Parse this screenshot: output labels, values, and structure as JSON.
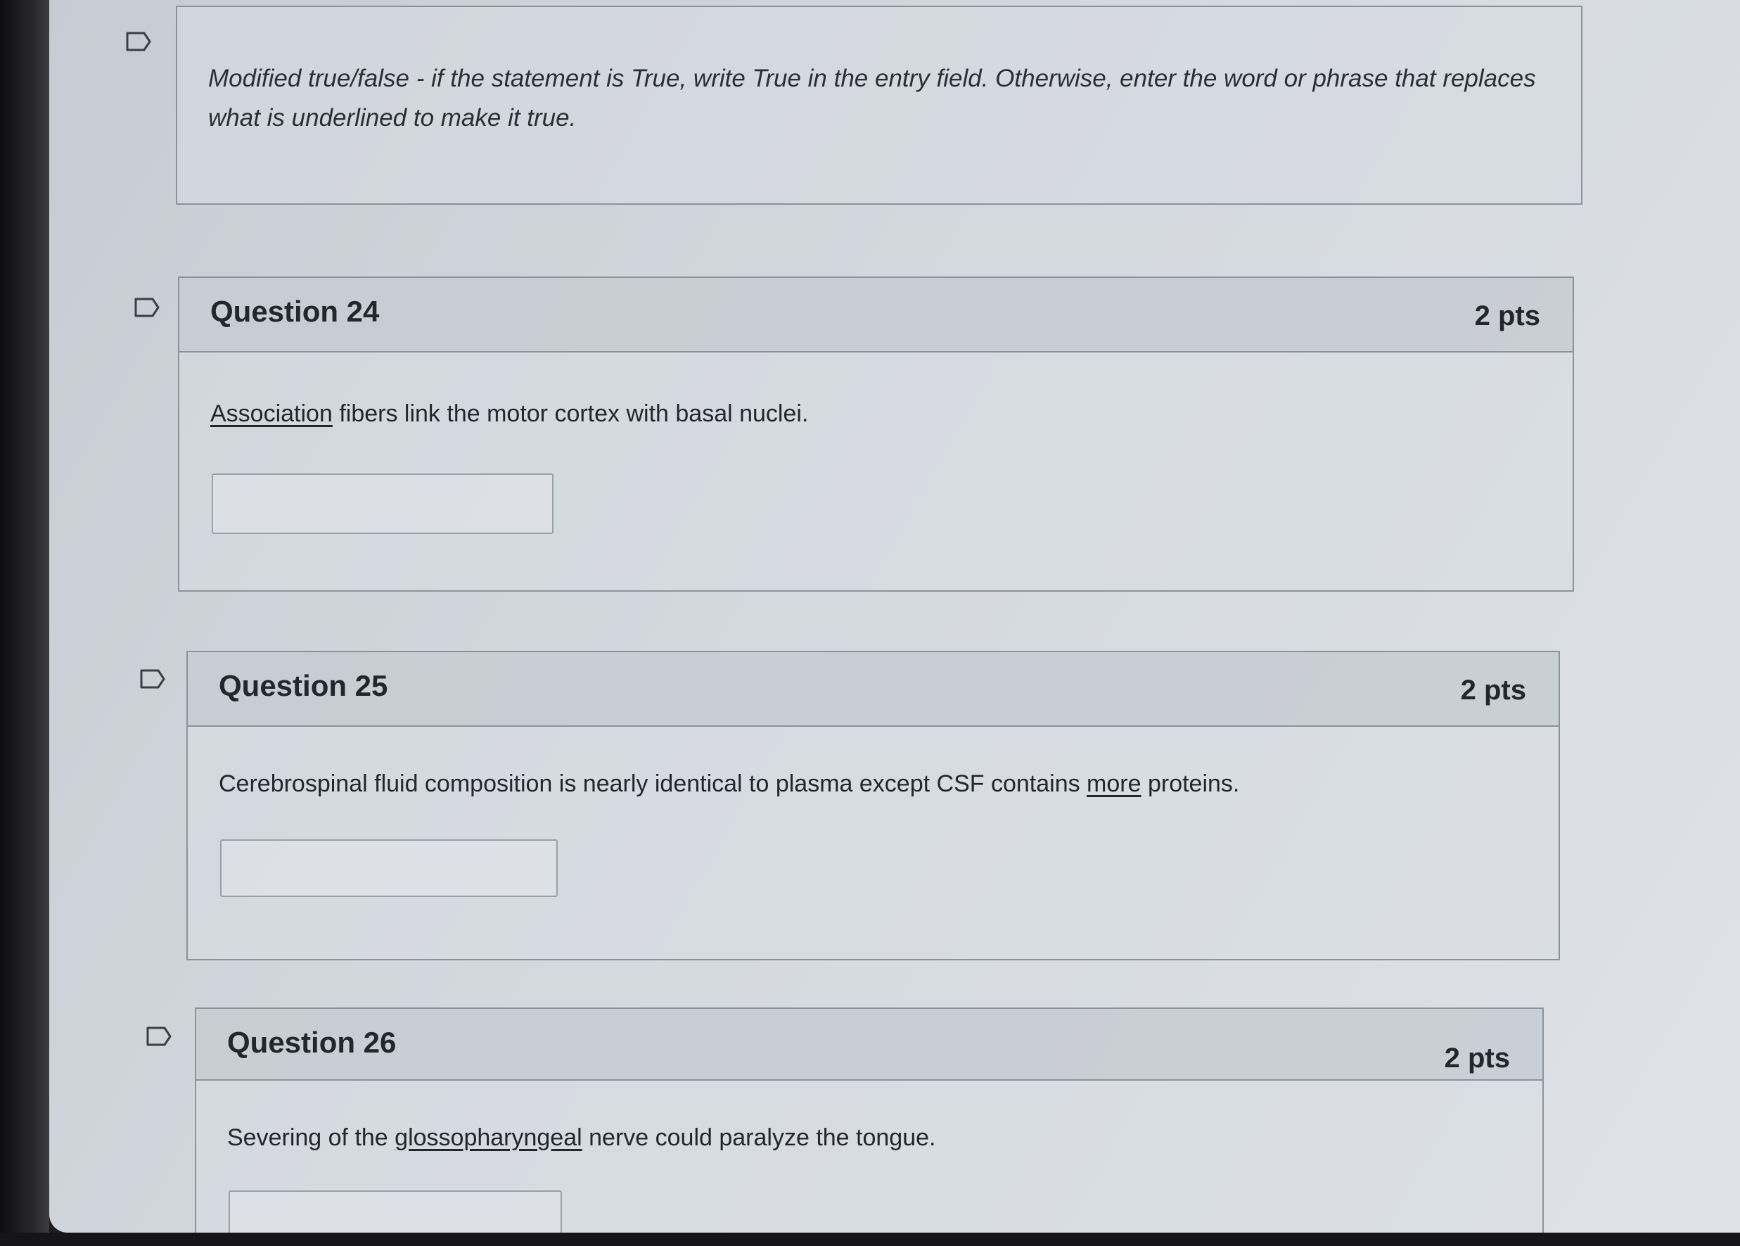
{
  "instructions": {
    "text": "Modified true/false - if the statement is True, write True in the entry field. Otherwise, enter the word or phrase that replaces what is underlined to make it true."
  },
  "questions": [
    {
      "title": "Question 24",
      "points": "2 pts",
      "text_before": "",
      "underlined": "Association",
      "text_after": " fibers link the motor cortex with basal nuclei.",
      "answer": ""
    },
    {
      "title": "Question 25",
      "points": "2 pts",
      "text_before": "Cerebrospinal fluid composition is nearly identical to plasma except CSF contains ",
      "underlined": "more",
      "text_after": " proteins.",
      "answer": ""
    },
    {
      "title": "Question 26",
      "points": "2 pts",
      "text_before": "Severing of the ",
      "underlined": "glossopharyngeal",
      "text_after": " nerve could paralyze the tongue.",
      "answer": ""
    }
  ],
  "icons": {
    "flag": "bookmark-flag-icon"
  },
  "colors": {
    "border": "#8e939b",
    "text": "#23272d"
  }
}
